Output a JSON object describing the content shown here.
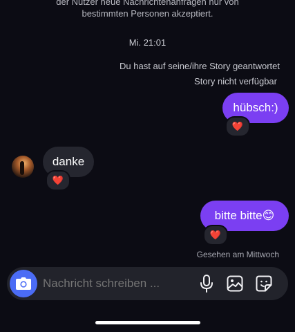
{
  "notice": {
    "line1": "der Nutzer neue Nachrichtenanfragen nur von",
    "line2": "bestimmten Personen akzeptiert."
  },
  "timestamp": "Mi. 21:01",
  "story": {
    "replied": "Du hast auf seine/ihre Story geantwortet",
    "unavailable": "Story nicht verfügbar"
  },
  "messages": [
    {
      "direction": "out",
      "text": "hübsch:)",
      "reaction": "❤️"
    },
    {
      "direction": "in",
      "text": "danke",
      "reaction": "❤️"
    },
    {
      "direction": "out",
      "text": "bitte bitte😊",
      "reaction": "❤️"
    }
  ],
  "seen_status": "Gesehen am Mittwoch",
  "composer": {
    "placeholder": "Nachricht schreiben ...",
    "camera_icon": "camera-icon",
    "mic_icon": "microphone-icon",
    "gallery_icon": "gallery-icon",
    "sticker_icon": "sticker-icon"
  },
  "colors": {
    "background": "#0c0c14",
    "outgoing_bubble": "#7b3ff2",
    "incoming_bubble": "#25262f",
    "camera_button": "#4b6cf5"
  }
}
